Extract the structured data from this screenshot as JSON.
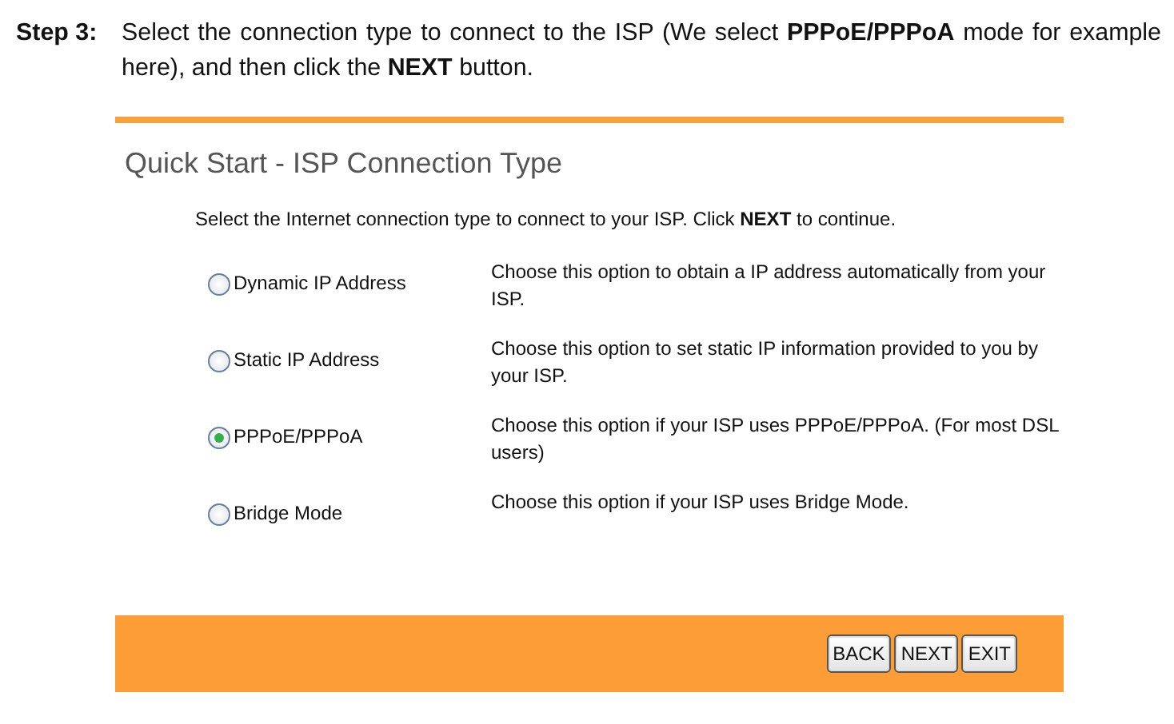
{
  "step": {
    "label": "Step 3:",
    "text": "Select the connection type to connect to the ISP (We select **PPPoE/PPPoA** mode for example here), and then click the **NEXT** button."
  },
  "panel": {
    "title": "Quick Start - ISP Connection Type",
    "intro": "Select the Internet connection type to connect to your ISP. Click **NEXT** to continue.",
    "options": [
      {
        "label": "Dynamic IP Address",
        "description": "Choose this option to obtain a IP address automatically from your ISP.",
        "selected": false
      },
      {
        "label": "Static IP Address",
        "description": "Choose this option to set static IP information provided to you by your ISP.",
        "selected": false
      },
      {
        "label": "PPPoE/PPPoA",
        "description": "Choose this option if your ISP uses PPPoE/PPPoA. (For most DSL users)",
        "selected": true
      },
      {
        "label": "Bridge Mode",
        "description": "Choose this option if your ISP uses Bridge Mode.",
        "selected": false
      }
    ],
    "buttons": [
      "BACK",
      "NEXT",
      "EXIT"
    ]
  }
}
